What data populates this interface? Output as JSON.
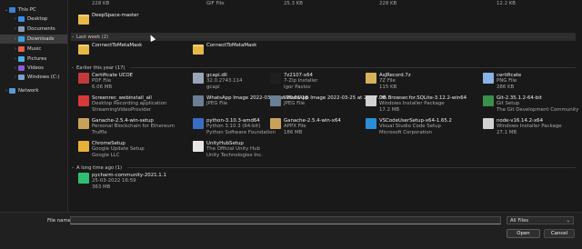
{
  "sidebar": {
    "items": [
      {
        "label": "This PC",
        "expand": "⌄",
        "color": "#3d7fd6"
      },
      {
        "label": "Desktop",
        "expand": "›",
        "color": "#3a8ee6"
      },
      {
        "label": "Documents",
        "expand": "›",
        "color": "#8a9bb0"
      },
      {
        "label": "Downloads",
        "expand": "›",
        "color": "#3aa3e6"
      },
      {
        "label": "Music",
        "expand": "›",
        "color": "#e6604a"
      },
      {
        "label": "Pictures",
        "expand": "›",
        "color": "#4ab0e6"
      },
      {
        "label": "Videos",
        "expand": "›",
        "color": "#8a5ad6"
      },
      {
        "label": "Windows (C:)",
        "expand": "›",
        "color": "#7aa0c8"
      },
      {
        "label": "Network",
        "expand": "›",
        "color": "#5a9ad6"
      }
    ]
  },
  "top_partial": [
    {
      "meta": "228 KB"
    },
    {
      "meta": "GIF File"
    },
    {
      "meta": "25.3 KB"
    },
    {
      "meta": "228 KB"
    },
    {
      "meta": "12.2 KB"
    }
  ],
  "groups": {
    "pre": {
      "items": [
        {
          "name": "DeepSpace-master",
          "color": "#e7b949"
        }
      ]
    },
    "last_week": {
      "title": "Last week (2)",
      "items": [
        {
          "name": "ConnectToMetaMask",
          "color": "#e7b949"
        },
        {
          "name": "ConnectToMetaMask",
          "color": "#e7b949"
        }
      ]
    },
    "earlier": {
      "title": "Earlier this year (17)",
      "items": [
        {
          "name": "Certificate UCOE",
          "type": "PDF File",
          "size": "6.06 MB",
          "color": "#c43a3a"
        },
        {
          "name": "gcapi.dll",
          "type": "32.0.2743.114",
          "size": "gcapi",
          "color": "#9aa6b8"
        },
        {
          "name": "7z2107-x64",
          "type": "7-Zip Installer",
          "size": "Igor Pavlov",
          "color": "#1f1f1f"
        },
        {
          "name": "AsJRecord.7z",
          "type": "7Z File",
          "size": "115 KB",
          "color": "#d6b25a"
        },
        {
          "name": "certificate",
          "type": "PNG File",
          "size": "286 KB",
          "color": "#8ab4e6"
        },
        {
          "name": "Screenrec_webinstall_all",
          "type": "Desktop Recording application",
          "size": "StreamingVideoProvider",
          "color": "#d63a3a"
        },
        {
          "name": "WhatsApp Image 2022-03-25 at 20.01.18",
          "type": "JPEG File",
          "size": "",
          "color": "#6a7f94"
        },
        {
          "name": "WhatsApp Image 2022-03-25 at 20.07.00",
          "type": "JPEG File",
          "size": "",
          "color": "#6a7f94"
        },
        {
          "name": "DB.Browser.for.SQLite-3.12.2-win64",
          "type": "Windows Installer Package",
          "size": "17.2 MB",
          "color": "#d1d1d1"
        },
        {
          "name": "Git-2.35.1.2-64-bit",
          "type": "Git Setup",
          "size": "The Git Development Community",
          "color": "#3a8f4a"
        },
        {
          "name": "Ganache-2.5.4-win-setup",
          "type": "Personal Blockchain for Ethereum",
          "size": "Truffle",
          "color": "#c9a25a"
        },
        {
          "name": "python-3.10.3-amd64",
          "type": "Python 3.10.3 (64-bit)",
          "size": "Python Software Foundation",
          "color": "#3a6ec4"
        },
        {
          "name": "Ganache-2.5.4-win-x64",
          "type": "APPX File",
          "size": "186 MB",
          "color": "#c9a25a"
        },
        {
          "name": "VSCodeUserSetup-x64-1.65.2",
          "type": "Visual Studio Code Setup",
          "size": "Microsoft Corporation",
          "color": "#2a8fd6"
        },
        {
          "name": "node-v16.14.2-x64",
          "type": "Windows Installer Package",
          "size": "27.1 MB",
          "color": "#d1d1d1"
        },
        {
          "name": "ChromeSetup",
          "type": "Google Update Setup",
          "size": "Google LLC",
          "color": "#e6b03a"
        },
        {
          "name": "UnityHubSetup",
          "type": "The Official Unity Hub",
          "size": "Unity Technologies Inc.",
          "color": "#e6e6e6"
        }
      ]
    },
    "long_ago": {
      "title": "A long time ago (1)",
      "items": [
        {
          "name": "pycharm-community-2021.1.1",
          "type": "25-03-2022 16:59",
          "size": "363 MB",
          "color": "#2fbf71"
        }
      ]
    }
  },
  "footer": {
    "file_name_label": "File name:",
    "file_name_value": "",
    "filter_value": "All Files",
    "filter_chevron": "⌄",
    "open_label": "Open",
    "cancel_label": "Cancel"
  }
}
